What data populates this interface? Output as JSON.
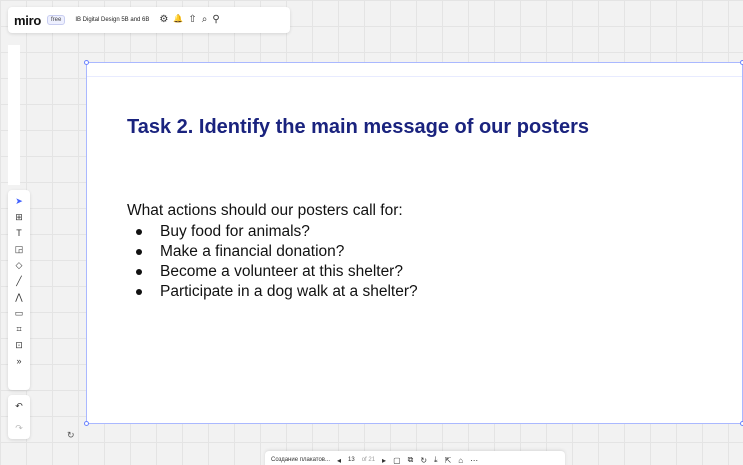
{
  "topbar": {
    "logo": "miro",
    "plan_badge": "free",
    "board_name": "IB Digital Design 5B and 6B",
    "icons": [
      {
        "name": "settings-icon",
        "glyph": "⚙"
      },
      {
        "name": "notifications-icon",
        "glyph": "🔔"
      },
      {
        "name": "share-icon",
        "glyph": "⇧"
      },
      {
        "name": "search-icon",
        "glyph": "⌕"
      },
      {
        "name": "pin-icon",
        "glyph": "⚲"
      }
    ]
  },
  "left_toolbar": {
    "tools": [
      {
        "name": "select-tool-icon",
        "glyph": "➤",
        "active": true
      },
      {
        "name": "template-tool-icon",
        "glyph": "⊞"
      },
      {
        "name": "text-tool-icon",
        "glyph": "T"
      },
      {
        "name": "sticky-note-tool-icon",
        "glyph": "◲"
      },
      {
        "name": "shapes-tool-icon",
        "glyph": "◇"
      },
      {
        "name": "pen-tool-icon",
        "glyph": "╱"
      },
      {
        "name": "connector-tool-icon",
        "glyph": "⋀"
      },
      {
        "name": "comment-tool-icon",
        "glyph": "▭"
      },
      {
        "name": "frame-tool-icon",
        "glyph": "⌗"
      },
      {
        "name": "upload-tool-icon",
        "glyph": "⊡"
      },
      {
        "name": "more-tools-icon",
        "glyph": "»"
      }
    ],
    "undo_glyph": "↶",
    "redo_glyph": "↷"
  },
  "slide": {
    "title": "Task 2. Identify the main message of our posters",
    "intro": "What actions should our posters call for:",
    "bullets": [
      "Buy food for animals?",
      "Make a financial donation?",
      "Become a volunteer at this shelter?",
      "Participate in a dog walk at a shelter?"
    ]
  },
  "bottom_bar": {
    "frame_name": "Создание плакатов...",
    "prev": "◂",
    "current_page": "13",
    "total_pages": "of 21",
    "next": "▸",
    "icons": [
      {
        "name": "slide-view-icon",
        "glyph": "▢"
      },
      {
        "name": "copy-frame-icon",
        "glyph": "⧉"
      },
      {
        "name": "present-icon",
        "glyph": "↻"
      },
      {
        "name": "download-icon",
        "glyph": "⤓"
      },
      {
        "name": "export-icon",
        "glyph": "⇱"
      },
      {
        "name": "lock-icon",
        "glyph": "⌂"
      },
      {
        "name": "more-icon",
        "glyph": "⋯"
      }
    ]
  },
  "colors": {
    "accent": "#4262ff",
    "title": "#1a237e",
    "frame_border": "#aab8ff"
  }
}
